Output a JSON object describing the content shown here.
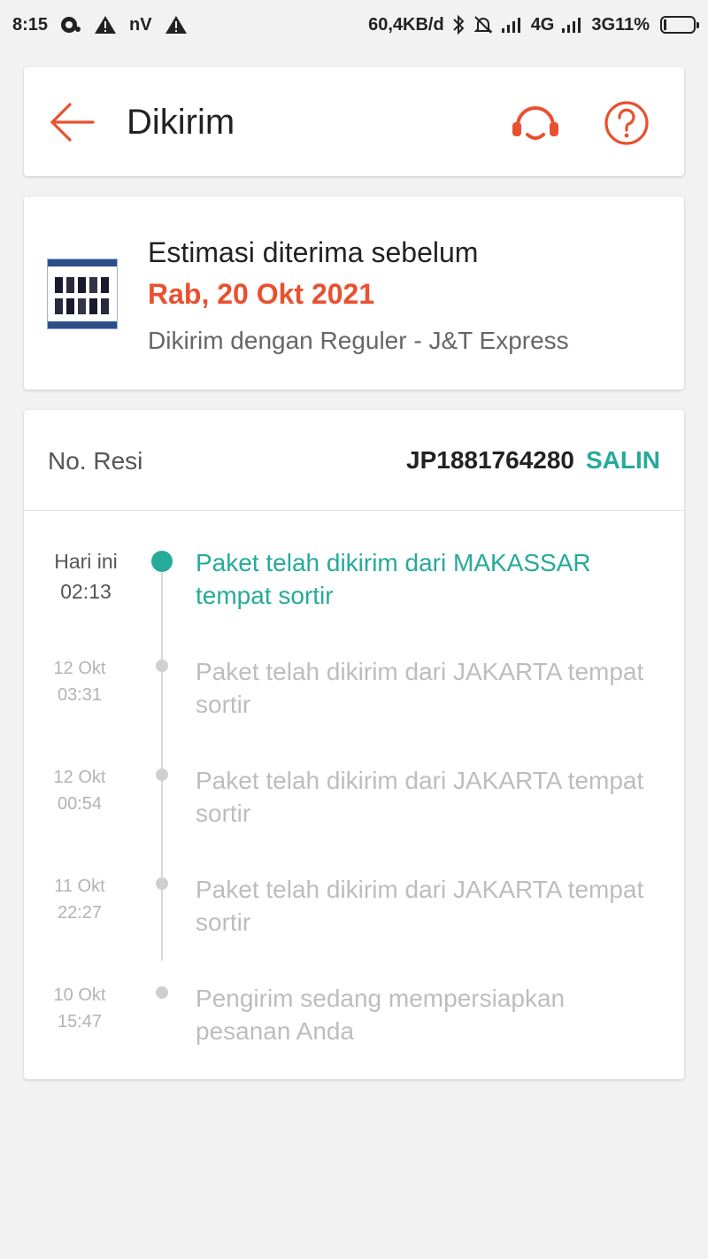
{
  "status_bar": {
    "time": "8:15",
    "net_label": "nV",
    "speed": "60,4KB/d",
    "network_4g": "4G",
    "network_3g": "3G",
    "battery": "11%"
  },
  "header": {
    "title": "Dikirim"
  },
  "estimate": {
    "label": "Estimasi diterima sebelum",
    "date": "Rab, 20 Okt 2021",
    "courier": "Dikirim dengan Reguler - J&T Express"
  },
  "tracking": {
    "resi_label": "No. Resi",
    "resi_number": "JP1881764280",
    "copy_label": "SALIN",
    "events": [
      {
        "date": "Hari ini",
        "time": "02:13",
        "text": "Paket telah dikirim dari MAKASSAR tempat sortir"
      },
      {
        "date": "12 Okt",
        "time": "03:31",
        "text": "Paket telah dikirim dari JAKARTA tempat sortir"
      },
      {
        "date": "12 Okt",
        "time": "00:54",
        "text": "Paket telah dikirim dari JAKARTA tempat sortir"
      },
      {
        "date": "11 Okt",
        "time": "22:27",
        "text": "Paket telah dikirim dari JAKARTA tempat sortir"
      },
      {
        "date": "10 Okt",
        "time": "15:47",
        "text": "Pengirim sedang mempersiapkan pesanan Anda"
      }
    ]
  },
  "colors": {
    "accent": "#e8512f",
    "teal": "#26aa99"
  }
}
